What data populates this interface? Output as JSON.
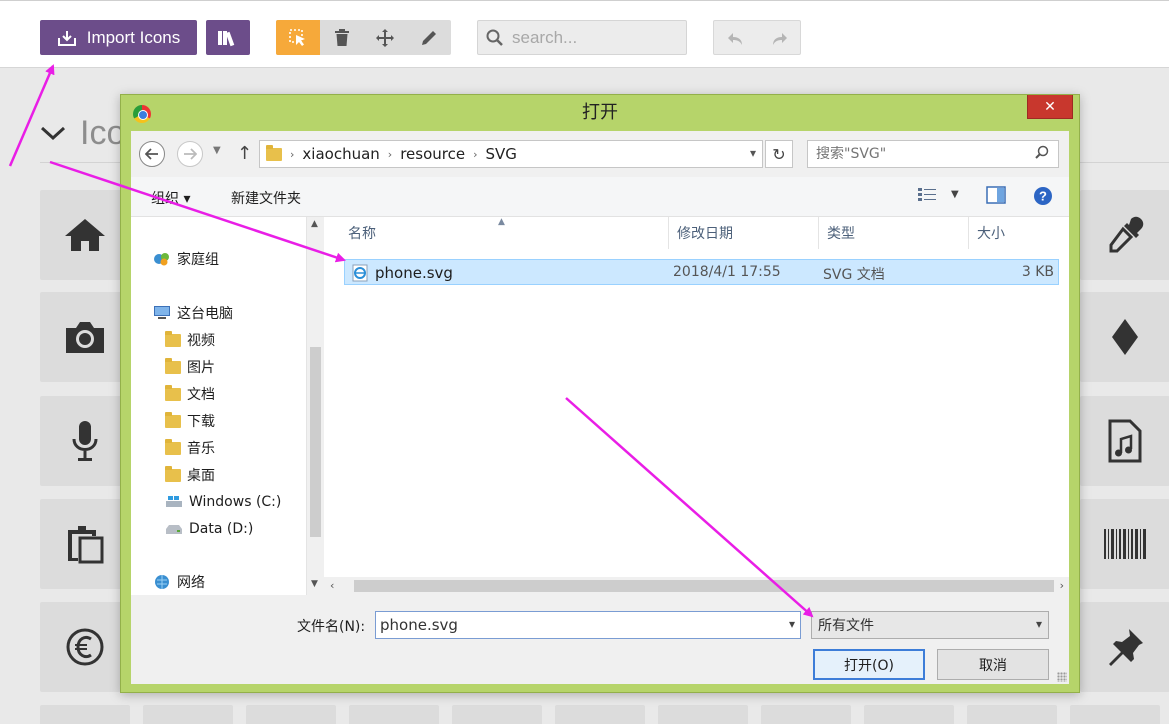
{
  "toolbar": {
    "import_label": "Import Icons",
    "search_placeholder": "search...",
    "accent_color": "#6c4d8a",
    "active_tool_color": "#f6a93a",
    "tools": [
      "pointer-icon",
      "trash-icon",
      "move-icon",
      "pencil-icon"
    ],
    "history": [
      "undo-icon",
      "redo-icon"
    ]
  },
  "section": {
    "title": "Ico"
  },
  "background_icons": {
    "left": [
      "home-icon",
      "camera-icon",
      "microphone-icon",
      "clipboard-icon",
      "euro-icon"
    ],
    "right": [
      "eyedropper-icon",
      "diamond-icon",
      "music-file-icon",
      "barcode-icon",
      "pushpin-icon"
    ]
  },
  "dialog": {
    "title": "打开",
    "close_glyph": "✕",
    "frame_color": "#b6d46a",
    "breadcrumb": [
      "xiaochuan",
      "resource",
      "SVG"
    ],
    "search_placeholder": "搜索\"SVG\"",
    "toolbar": {
      "organize": "组织 ▾",
      "new_folder": "新建文件夹"
    },
    "nav": {
      "homegroup": "家庭组",
      "this_pc": "这台电脑",
      "folders": [
        "视频",
        "图片",
        "文档",
        "下载",
        "音乐",
        "桌面"
      ],
      "drives": [
        "Windows (C:)",
        "Data (D:)"
      ],
      "network": "网络"
    },
    "columns": {
      "name": "名称",
      "modified": "修改日期",
      "type": "类型",
      "size": "大小"
    },
    "files": [
      {
        "name": "phone.svg",
        "modified": "2018/4/1 17:55",
        "type": "SVG 文档",
        "size": "3 KB"
      }
    ],
    "filename_label": "文件名(N):",
    "filename_value": "phone.svg",
    "filter_value": "所有文件",
    "open_button": "打开(O)",
    "cancel_button": "取消"
  },
  "annotation_color": "#e91ee6"
}
